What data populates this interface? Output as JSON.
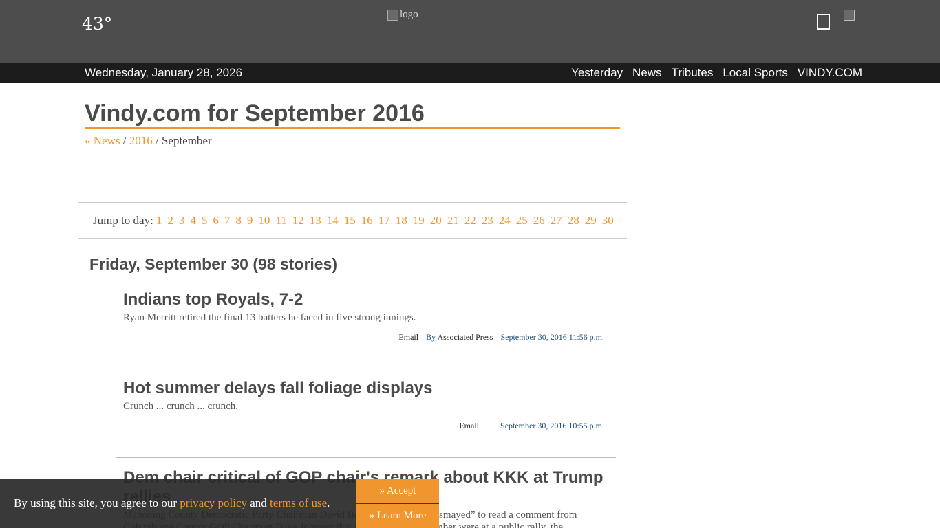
{
  "header": {
    "temperature": "43°",
    "logo_alt": "logo"
  },
  "nav": {
    "date": "Wednesday, January 28, 2026",
    "links": [
      "Yesterday",
      "News",
      "Tributes",
      "Local Sports",
      "VINDY.COM"
    ]
  },
  "page": {
    "title": "Vindy.com for September 2016",
    "breadcrumb": {
      "news": "« News",
      "sep1": " / ",
      "year": "2016",
      "sep2": " / ",
      "month": "September"
    },
    "jump_label": "Jump to day:",
    "days": [
      "1",
      "2",
      "3",
      "4",
      "5",
      "6",
      "7",
      "8",
      "9",
      "10",
      "11",
      "12",
      "13",
      "14",
      "15",
      "16",
      "17",
      "18",
      "19",
      "20",
      "21",
      "22",
      "23",
      "24",
      "25",
      "26",
      "27",
      "28",
      "29",
      "30"
    ],
    "day_heading": "Friday, September 30 (98 stories)"
  },
  "stories": [
    {
      "title": "Indians top Royals, 7-2",
      "teaser": "Ryan Merritt retired the final 13 batters he faced in five strong innings.",
      "email": "Email",
      "by": "By",
      "author": "Associated Press",
      "time": "September 30, 2016 11:56 p.m."
    },
    {
      "title": "Hot summer delays fall foliage displays",
      "teaser": "Crunch ... crunch ... crunch.",
      "email": "Email",
      "time": "September 30, 2016 10:55 p.m."
    },
    {
      "title": "Dem chair critical of GOP chair's remark about KKK at Trump rallies",
      "teaser": "Mahoning County Democratic Party Chairman David Betras said he was “dismayed” to read a comment from Columbiana County GOP Chairman Dave Johnson that a Ku Klux Klan member were at a public rally, the"
    }
  ],
  "cookie": {
    "prefix": "By using this site, you agree to our ",
    "privacy": "privacy policy",
    "and": " and ",
    "terms": "terms of use",
    "suffix": ".",
    "accept": "» Accept",
    "learn_more": "» Learn More"
  }
}
